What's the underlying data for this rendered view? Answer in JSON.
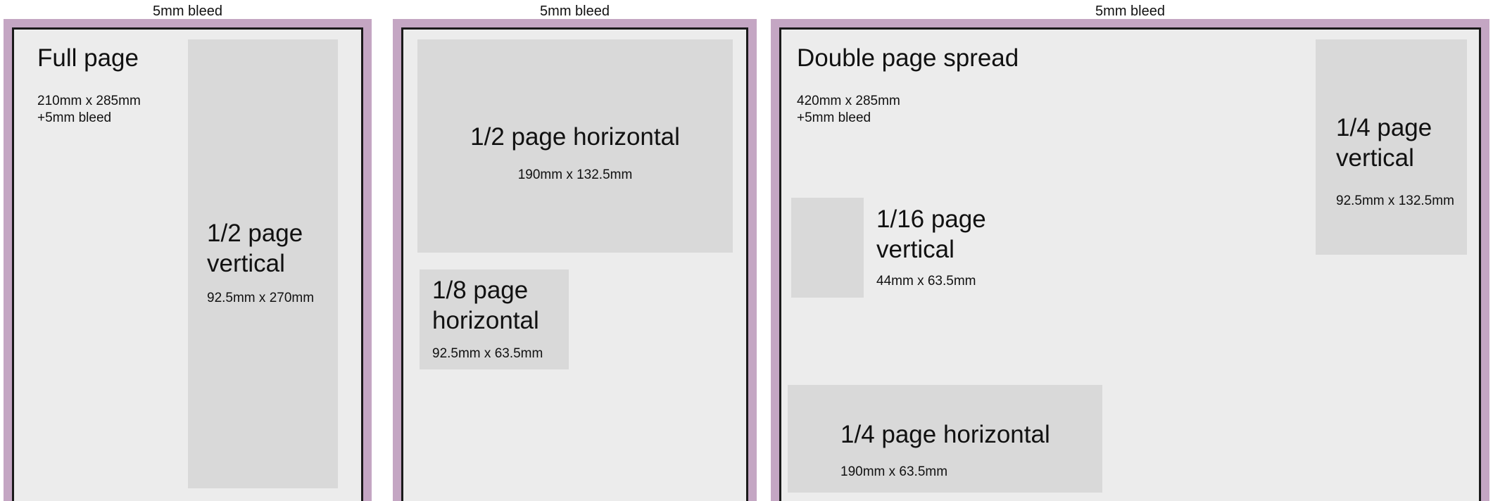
{
  "bleed_label": "5mm bleed",
  "colors": {
    "bleed": "#c4a6c3",
    "page": "#ececec",
    "ad_area": "#d9d9d9",
    "trim_line": "#1a1a1a"
  },
  "pages": [
    {
      "title": "Full page",
      "dimensions": "210mm x 285mm",
      "bleed_note": "+5mm bleed",
      "ads": [
        {
          "title_line1": "1/2 page",
          "title_line2": "vertical",
          "dimensions": "92.5mm x 270mm"
        }
      ]
    },
    {
      "ads": [
        {
          "title_line1": "1/2 page horizontal",
          "dimensions": "190mm x 132.5mm"
        },
        {
          "title_line1": "1/8 page",
          "title_line2": "horizontal",
          "dimensions": "92.5mm x 63.5mm"
        }
      ]
    },
    {
      "title": "Double page spread",
      "dimensions": "420mm x 285mm",
      "bleed_note": "+5mm bleed",
      "ads": [
        {
          "title_line1": "1/4 page",
          "title_line2": "vertical",
          "dimensions": "92.5mm x 132.5mm"
        },
        {
          "title_line1": "1/16 page",
          "title_line2": "vertical",
          "dimensions": "44mm x 63.5mm"
        },
        {
          "title_line1": "1/4 page horizontal",
          "dimensions": "190mm x 63.5mm"
        }
      ]
    }
  ]
}
